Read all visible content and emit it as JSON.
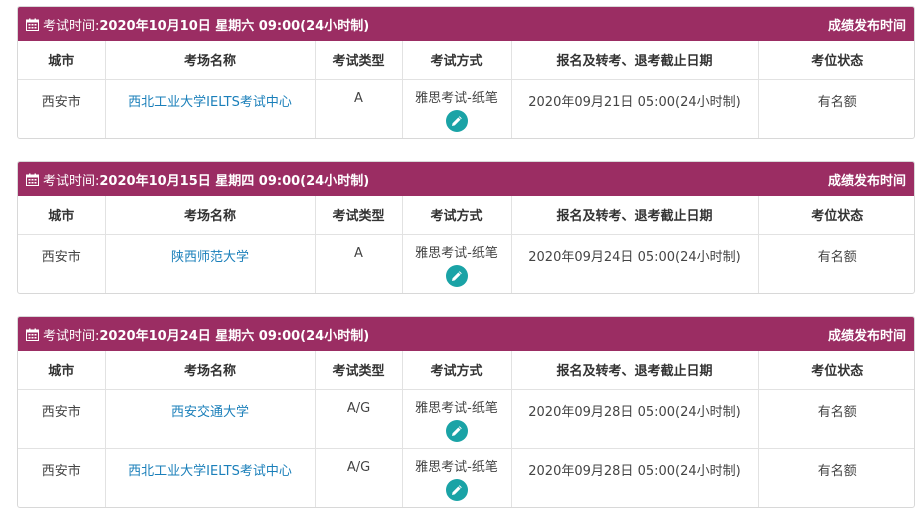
{
  "columns": [
    "城市",
    "考场名称",
    "考试类型",
    "考试方式",
    "报名及转考、退考截止日期",
    "考位状态"
  ],
  "time_label": "考试时间:",
  "release_label": "成绩发布时间",
  "icons": {
    "calendar": "calendar-icon",
    "edit": "pencil-icon"
  },
  "colors": {
    "header": "#9b2d63",
    "link": "#1a7fba",
    "edit_button": "#1aa3a6"
  },
  "sessions": [
    {
      "exam_time": "2020年10月10日 星期六 09:00(24小时制)",
      "rows": [
        {
          "city": "西安市",
          "venue": "西北工业大学IELTS考试中心",
          "type": "A",
          "method": "雅思考试-纸笔",
          "deadline": "2020年09月21日 05:00(24小时制)",
          "status": "有名额"
        }
      ]
    },
    {
      "exam_time": "2020年10月15日 星期四 09:00(24小时制)",
      "rows": [
        {
          "city": "西安市",
          "venue": "陕西师范大学",
          "type": "A",
          "method": "雅思考试-纸笔",
          "deadline": "2020年09月24日 05:00(24小时制)",
          "status": "有名额"
        }
      ]
    },
    {
      "exam_time": "2020年10月24日 星期六 09:00(24小时制)",
      "rows": [
        {
          "city": "西安市",
          "venue": "西安交通大学",
          "type": "A/G",
          "method": "雅思考试-纸笔",
          "deadline": "2020年09月28日 05:00(24小时制)",
          "status": "有名额"
        },
        {
          "city": "西安市",
          "venue": "西北工业大学IELTS考试中心",
          "type": "A/G",
          "method": "雅思考试-纸笔",
          "deadline": "2020年09月28日 05:00(24小时制)",
          "status": "有名额"
        }
      ]
    }
  ]
}
